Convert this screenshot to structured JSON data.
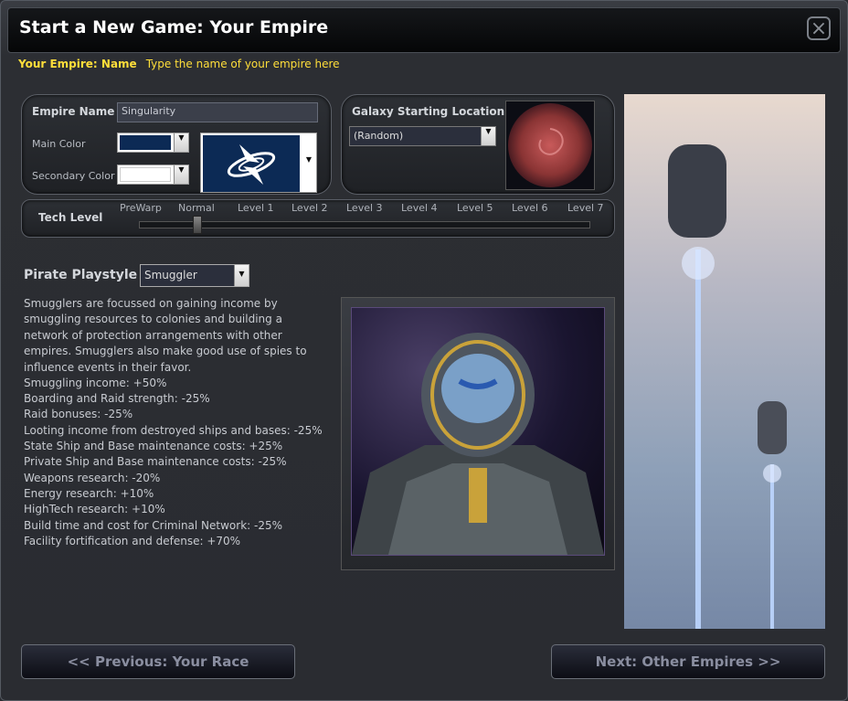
{
  "window": {
    "title": "Start a New Game: Your Empire",
    "close_icon": "close-icon"
  },
  "hint": {
    "label": "Your Empire: Name",
    "text": "Type the name of your empire here"
  },
  "empire": {
    "name_label": "Empire Name",
    "name_value": "Singularity",
    "main_color_label": "Main Color",
    "main_color": "#0c2a55",
    "secondary_color_label": "Secondary Color",
    "secondary_color": "#ffffff",
    "flag_icon": "empire-flag-icon"
  },
  "galaxy": {
    "label": "Galaxy Starting Location",
    "location_value": "(Random)",
    "map_icon": "galaxy-map-image"
  },
  "tech": {
    "label": "Tech Level",
    "levels": [
      "PreWarp",
      "Normal",
      "Level 1",
      "Level 2",
      "Level 3",
      "Level 4",
      "Level 5",
      "Level 6",
      "Level 7"
    ],
    "selected_index": 1
  },
  "playstyle": {
    "label": "Pirate Playstyle",
    "value": "Smuggler",
    "description": "Smugglers are focussed on gaining income by smuggling resources to colonies and building a network of protection arrangements with other empires. Smugglers also make good use of spies to influence events in their favor.",
    "stats": [
      "Smuggling income: +50%",
      "Boarding and Raid strength: -25%",
      "Raid bonuses: -25%",
      "Looting income from destroyed ships and bases: -25%",
      "State Ship and Base maintenance costs: +25%",
      "Private Ship and Base maintenance costs: -25%",
      "Weapons research: -20%",
      "Energy research: +10%",
      "HighTech research: +10%",
      "Build time and cost for Criminal Network: -25%",
      "Facility fortification and defense: +70%"
    ],
    "portrait_icon": "pirate-portrait-image"
  },
  "nav": {
    "previous": "<< Previous: Your Race",
    "next": "Next: Other Empires >>"
  },
  "side_image": "space-elevator-image"
}
